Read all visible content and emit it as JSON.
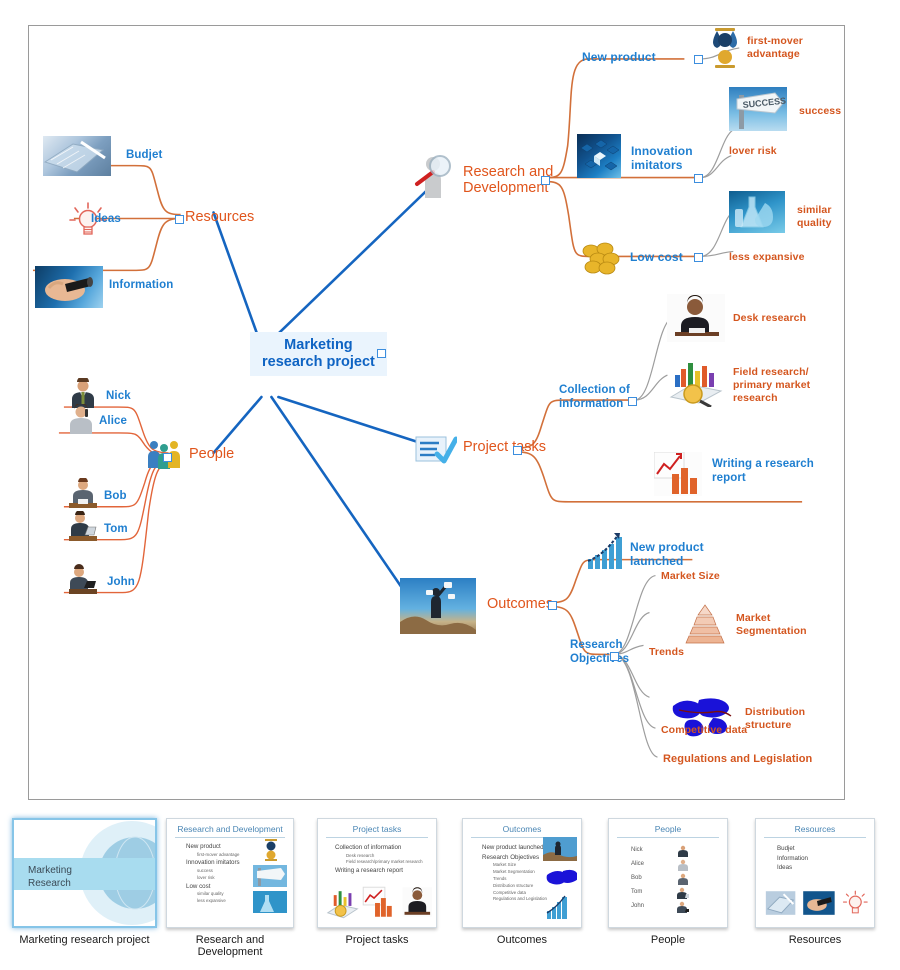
{
  "central": {
    "line1": "Marketing",
    "line2": "research project"
  },
  "branches": {
    "resources": {
      "label": "Resources",
      "children": [
        {
          "label": "Budjet",
          "icon": "keyboard-pen-image",
          "color": "blue"
        },
        {
          "label": "Ideas",
          "icon": "lightbulb-image",
          "color": "blue"
        },
        {
          "label": "Information",
          "icon": "hand-telescope-image",
          "color": "blue"
        }
      ]
    },
    "people": {
      "label": "People",
      "icon": "three-people-image",
      "children": [
        {
          "label": "Nick",
          "icon": "man-headset-image"
        },
        {
          "label": "Alice",
          "icon": "woman-phone-image"
        },
        {
          "label": "Bob",
          "icon": "man-desk-image"
        },
        {
          "label": "Tom",
          "icon": "man-laptop-image"
        },
        {
          "label": "John",
          "icon": "man-laptop2-image"
        }
      ]
    },
    "research_and_development": {
      "label_line1": "Research and",
      "label_line2": "Development",
      "icon": "magnifier-figure-image",
      "children": [
        {
          "label": "New product",
          "color": "blue",
          "sub": [
            {
              "label_line1": "first-mover",
              "label_line2": "advantage",
              "icon": "hourglass-image"
            }
          ]
        },
        {
          "label_line1": "Innovation",
          "label_line2": "imitators",
          "color": "blue",
          "icon": "blue-cubes-image",
          "sub": [
            {
              "label": "success",
              "icon": "success-signpost-image"
            },
            {
              "label": "lover risk"
            }
          ]
        },
        {
          "label": "Low cost",
          "color": "blue",
          "icon": "gold-coins-image",
          "sub": [
            {
              "label_line1": "similar",
              "label_line2": "quality",
              "icon": "blue-flasks-image"
            },
            {
              "label": "less expansive"
            }
          ]
        }
      ]
    },
    "project_tasks": {
      "label": "Project tasks",
      "icon": "checklist-image",
      "children": [
        {
          "label_line1": "Collection of",
          "label_line2": "information",
          "color": "blue",
          "sub": [
            {
              "label": "Desk research",
              "icon": "woman-writing-image"
            },
            {
              "label_line1": "Field research/",
              "label_line2": "primary market",
              "label_line3": "research",
              "icon": "charts-magnifier-image"
            }
          ]
        },
        {
          "label_line1": "Writing a research",
          "label_line2": "report",
          "color": "blue",
          "icon": "red-bar-chart-image"
        }
      ]
    },
    "outcomes": {
      "label": "Outcomes",
      "icon": "man-mountain-image",
      "children": [
        {
          "label_line1": "New product",
          "label_line2": "launched",
          "color": "blue",
          "icon": "growth-chart-image"
        },
        {
          "label_line1": "Research",
          "label_line2": "Objectives",
          "color": "blue",
          "sub": [
            {
              "label": "Market Size"
            },
            {
              "label_line1": "Market",
              "label_line2": "Segmentation",
              "icon": "pyramid-image"
            },
            {
              "label": "Trends"
            },
            {
              "label_line1": "Distribution",
              "label_line2": "structure",
              "icon": "world-map-image"
            },
            {
              "label": "Competitive data"
            },
            {
              "label": "Regulations and Legislation"
            }
          ]
        }
      ]
    }
  },
  "thumbnails": [
    {
      "caption": "Marketing research project",
      "selected": true,
      "type": "title-slide",
      "title_line1": "Marketing",
      "title_line2": "Research"
    },
    {
      "caption": "Research and Development",
      "selected": false,
      "type": "outline",
      "title": "Research and Development",
      "lines": [
        {
          "text": "New product",
          "level": 1
        },
        {
          "text": "first-mover advantage",
          "level": 2
        },
        {
          "text": "Innovation imitators",
          "level": 1
        },
        {
          "text": "success",
          "level": 2
        },
        {
          "text": "lover risk",
          "level": 2
        },
        {
          "text": "Low cost",
          "level": 1
        },
        {
          "text": "similar quality",
          "level": 2
        },
        {
          "text": "less expansive",
          "level": 2
        }
      ]
    },
    {
      "caption": "Project tasks",
      "selected": false,
      "type": "outline",
      "title": "Project tasks",
      "lines": [
        {
          "text": "Collection of information",
          "level": 1
        },
        {
          "text": "Desk research",
          "level": 2
        },
        {
          "text": "Field research/primary market research",
          "level": 2
        },
        {
          "text": "Writing a research report",
          "level": 1
        }
      ]
    },
    {
      "caption": "Outcomes",
      "selected": false,
      "type": "outline",
      "title": "Outcomes",
      "lines": [
        {
          "text": "New product launched",
          "level": 1
        },
        {
          "text": "Research Objectives",
          "level": 1
        },
        {
          "text": "Market Size",
          "level": 2
        },
        {
          "text": "Market Segmentation",
          "level": 2
        },
        {
          "text": "Trends",
          "level": 2
        },
        {
          "text": "Distribution structure",
          "level": 2
        },
        {
          "text": "Competitive data",
          "level": 2
        },
        {
          "text": "Regulations and Legislation",
          "level": 2
        }
      ]
    },
    {
      "caption": "People",
      "selected": false,
      "type": "list",
      "title": "People",
      "lines": [
        {
          "text": "Nick",
          "level": 1
        },
        {
          "text": "Alice",
          "level": 1
        },
        {
          "text": "Bob",
          "level": 1
        },
        {
          "text": "Tom",
          "level": 1
        },
        {
          "text": "John",
          "level": 1
        }
      ]
    },
    {
      "caption": "Resources",
      "selected": false,
      "type": "outline",
      "title": "Resources",
      "lines": [
        {
          "text": "Budjet",
          "level": 1
        },
        {
          "text": "Information",
          "level": 1
        },
        {
          "text": "Ideas",
          "level": 1
        }
      ]
    }
  ],
  "colors": {
    "central_text": "#0e63c3",
    "central_bg": "#eaf4fd",
    "main_branch_text": "#e0551c",
    "sub_blue": "#1f7fd0",
    "sub_orange": "#d4561f",
    "branch_line": "#d2703a",
    "radial_line": "#1565c0",
    "thin_line": "#9d9d9d",
    "canvas_border": "#9a9a9a",
    "thumb_title": "#4a86b4"
  }
}
